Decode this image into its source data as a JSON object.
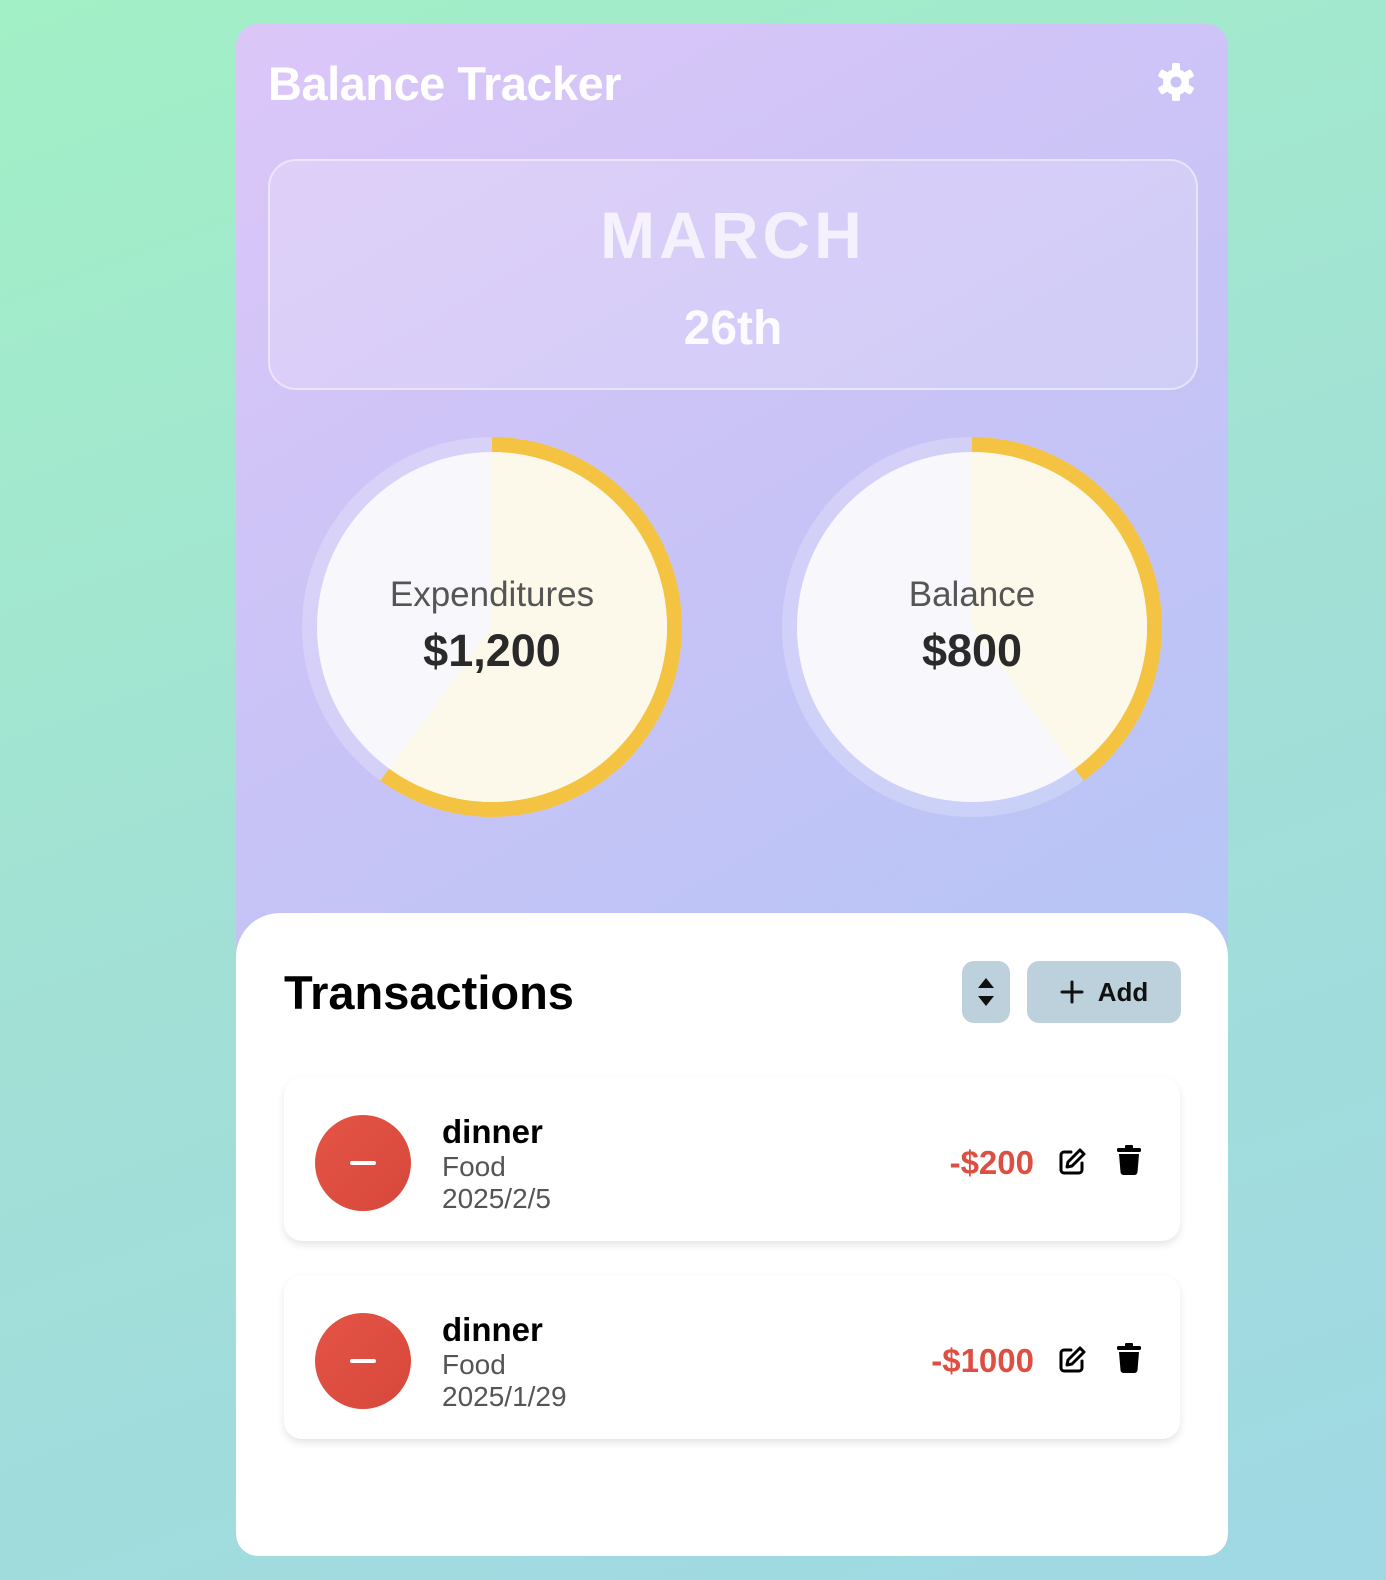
{
  "app": {
    "title": "Balance Tracker"
  },
  "date": {
    "month": "MARCH",
    "day": "26th"
  },
  "gauges": [
    {
      "label": "Expenditures",
      "value": "$1,200",
      "fraction": 0.6
    },
    {
      "label": "Balance",
      "value": "$800",
      "fraction": 0.4
    }
  ],
  "colors": {
    "accent": "#f5c342",
    "expense": "#dc4f42",
    "button": "#bdd1dc"
  },
  "transactions": {
    "title": "Transactions",
    "add_label": "Add",
    "items": [
      {
        "name": "dinner",
        "category": "Food",
        "date": "2025/2/5",
        "amount": "-$200"
      },
      {
        "name": "dinner",
        "category": "Food",
        "date": "2025/1/29",
        "amount": "-$1000"
      }
    ]
  },
  "icons": [
    "gear-icon",
    "sort-icon",
    "plus-icon",
    "minus-icon",
    "edit-icon",
    "trash-icon"
  ]
}
